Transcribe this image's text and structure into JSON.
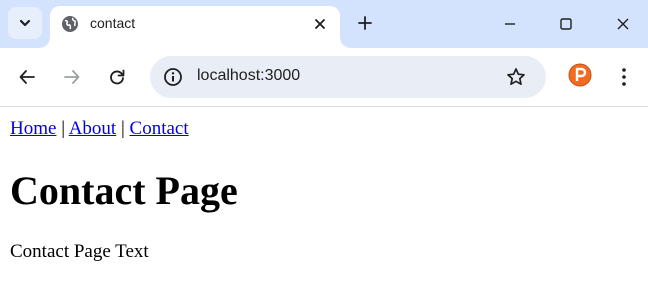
{
  "browser": {
    "tab": {
      "title": "contact",
      "favicon": "globe-icon"
    },
    "address_bar": {
      "url": "localhost:3000"
    },
    "colors": {
      "tabstrip": "#d3e3fd",
      "omnibox": "#e9eef6",
      "extension": "#f26b22"
    }
  },
  "page": {
    "nav": {
      "items": [
        {
          "label": "Home"
        },
        {
          "label": "About"
        },
        {
          "label": "Contact"
        }
      ],
      "separator": "|"
    },
    "heading": "Contact Page",
    "body_text": "Contact Page Text",
    "colors": {
      "link": "#0000ee",
      "text": "#000000"
    }
  }
}
